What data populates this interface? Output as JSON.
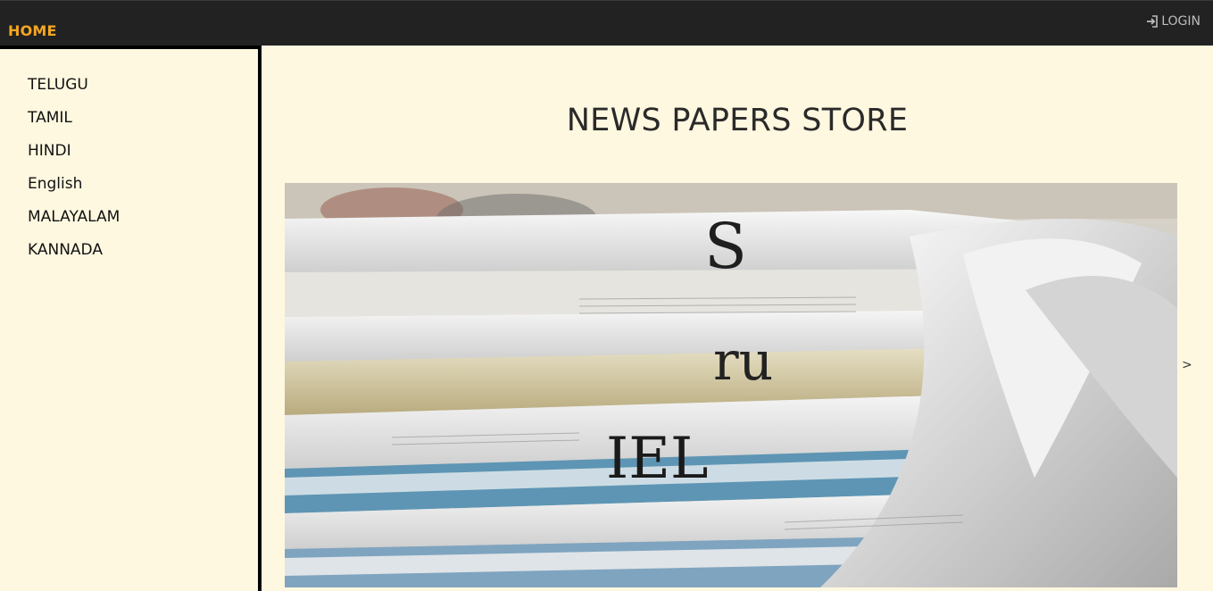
{
  "nav": {
    "home_label": "HOME",
    "login_label": "LOGIN",
    "home_color": "#f5a623",
    "bar_color": "#222222"
  },
  "sidebar": {
    "items": [
      {
        "label": "TELUGU"
      },
      {
        "label": "TAMIL"
      },
      {
        "label": "HINDI"
      },
      {
        "label": "English"
      },
      {
        "label": "MALAYALAM"
      },
      {
        "label": "KANNADA"
      }
    ]
  },
  "main": {
    "title": "NEWS PAPERS STORE",
    "carousel": {
      "next_label": ">",
      "image_icon": "newspaper-stack-photo"
    },
    "background_color": "#fff8e0"
  }
}
